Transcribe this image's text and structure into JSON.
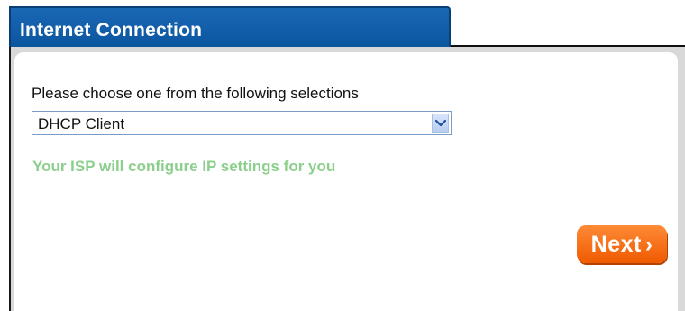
{
  "tab": {
    "title": "Internet Connection"
  },
  "connection": {
    "prompt": "Please choose one from the following selections",
    "selected": "DHCP Client",
    "note": "Your ISP will configure IP settings for you"
  },
  "actions": {
    "next_label": "Next",
    "next_chevron": "›"
  },
  "colors": {
    "tab_bg": "#0c56a0",
    "note_text": "#8ccf8c",
    "next_button": "#ef5a00"
  },
  "icons": {
    "select_arrow": "chevron-down-icon"
  }
}
